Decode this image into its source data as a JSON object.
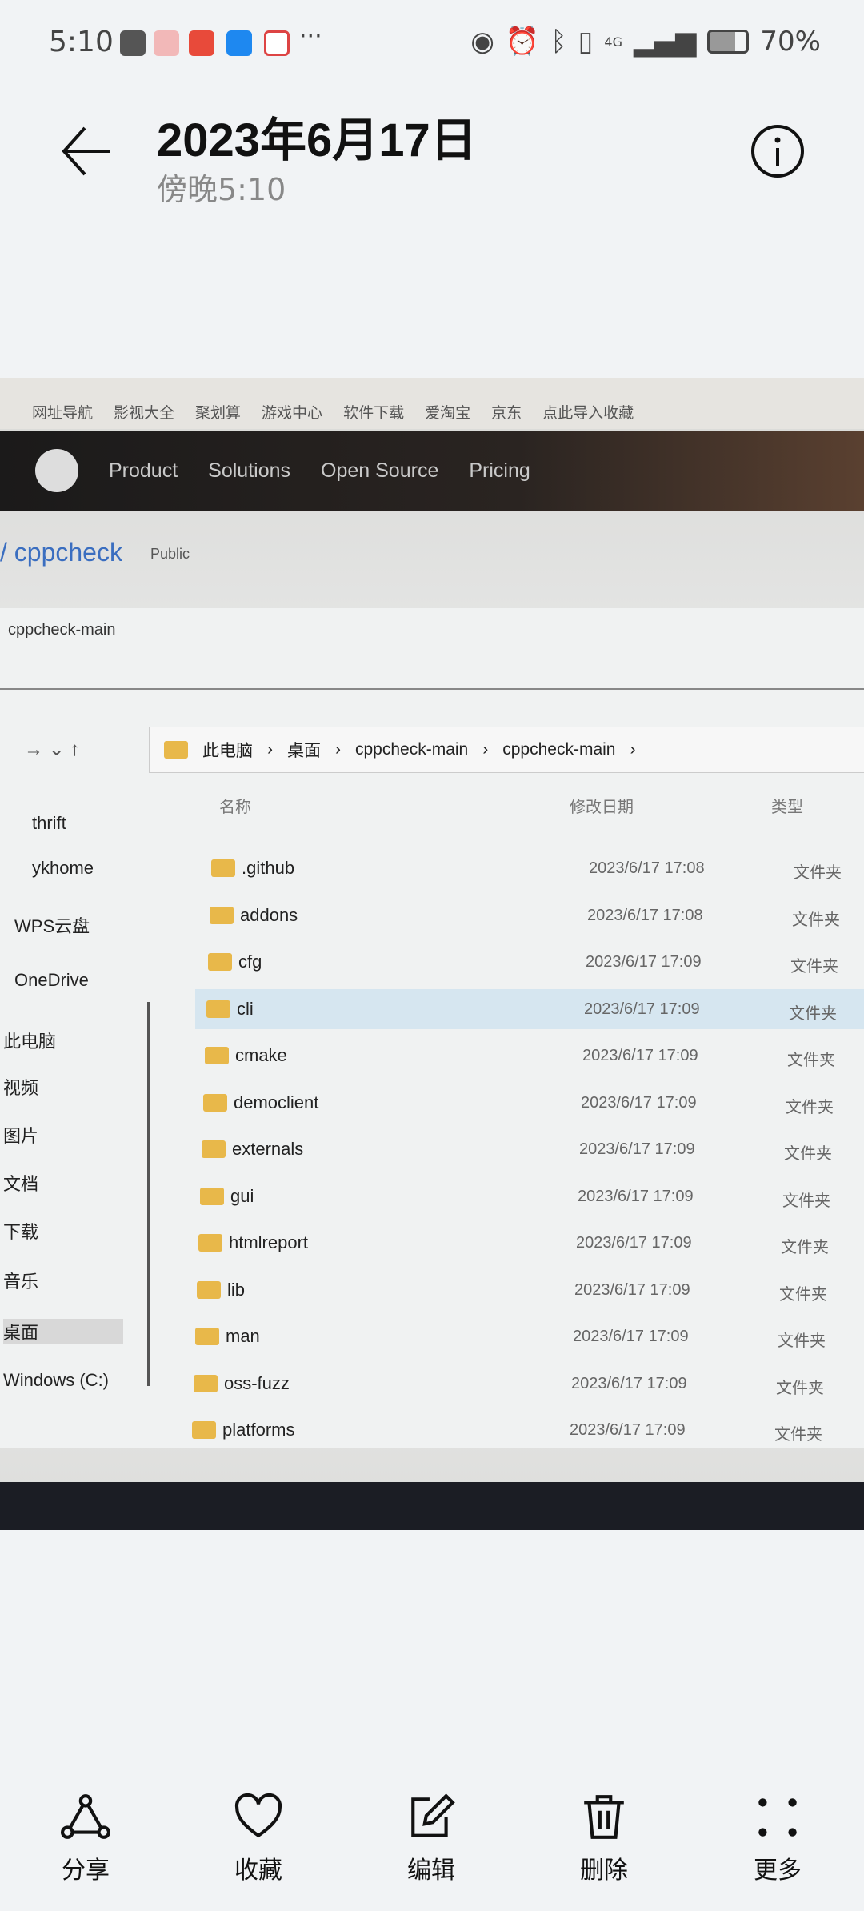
{
  "status_bar": {
    "time": "5:10",
    "battery": "70%",
    "network": "4G",
    "notification_colors": [
      "#555555",
      "#f2b8b8",
      "#e84a3a",
      "#1e88f0",
      "#ffffff"
    ]
  },
  "header": {
    "title": "2023年6月17日",
    "subtitle": "傍晚5:10"
  },
  "photo": {
    "bookmarks": [
      "网址导航",
      "影视大全",
      "聚划算",
      "游戏中心",
      "软件下载",
      "爱淘宝",
      "京东",
      "点此导入收藏"
    ],
    "github_nav": [
      "Product",
      "Solutions",
      "Open Source",
      "Pricing"
    ],
    "repo": "/ cppcheck",
    "visibility": "Public",
    "window_title": "cppcheck-main",
    "breadcrumb": [
      "此电脑",
      "桌面",
      "cppcheck-main",
      "cppcheck-main"
    ],
    "columns": [
      "名称",
      "修改日期",
      "类型"
    ],
    "sidebar": [
      "thrift",
      "ykhome",
      "WPS云盘",
      "OneDrive",
      "此电脑",
      "视频",
      "图片",
      "文档",
      "下载",
      "音乐",
      "桌面",
      "Windows (C:)"
    ],
    "files": [
      {
        "name": ".github",
        "date": "2023/6/17 17:08",
        "type": "文件夹"
      },
      {
        "name": "addons",
        "date": "2023/6/17 17:08",
        "type": "文件夹"
      },
      {
        "name": "cfg",
        "date": "2023/6/17 17:09",
        "type": "文件夹"
      },
      {
        "name": "cli",
        "date": "2023/6/17 17:09",
        "type": "文件夹"
      },
      {
        "name": "cmake",
        "date": "2023/6/17 17:09",
        "type": "文件夹"
      },
      {
        "name": "democlient",
        "date": "2023/6/17 17:09",
        "type": "文件夹"
      },
      {
        "name": "externals",
        "date": "2023/6/17 17:09",
        "type": "文件夹"
      },
      {
        "name": "gui",
        "date": "2023/6/17 17:09",
        "type": "文件夹"
      },
      {
        "name": "htmlreport",
        "date": "2023/6/17 17:09",
        "type": "文件夹"
      },
      {
        "name": "lib",
        "date": "2023/6/17 17:09",
        "type": "文件夹"
      },
      {
        "name": "man",
        "date": "2023/6/17 17:09",
        "type": "文件夹"
      },
      {
        "name": "oss-fuzz",
        "date": "2023/6/17 17:09",
        "type": "文件夹"
      },
      {
        "name": "platforms",
        "date": "2023/6/17 17:09",
        "type": "文件夹"
      }
    ]
  },
  "actions": [
    {
      "label": "分享",
      "icon": "share-icon"
    },
    {
      "label": "收藏",
      "icon": "heart-icon"
    },
    {
      "label": "编辑",
      "icon": "edit-icon"
    },
    {
      "label": "删除",
      "icon": "trash-icon"
    },
    {
      "label": "更多",
      "icon": "more-icon"
    }
  ]
}
